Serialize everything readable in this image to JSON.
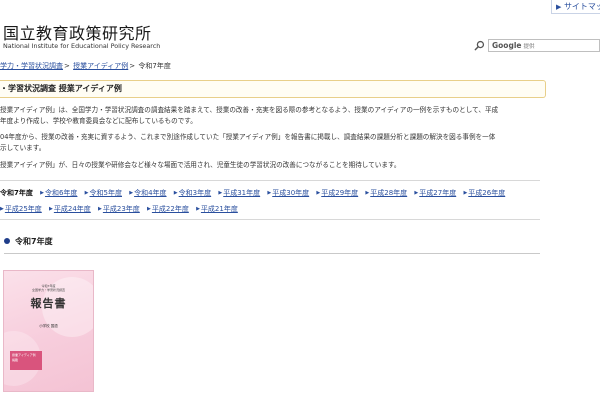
{
  "header": {
    "sitemap_label": "サイトマップ",
    "logo_jp": "国立教育政策研究所",
    "logo_en": "National Institute for Educational Policy Research",
    "search_provider": "Google",
    "search_suffix": "提供"
  },
  "breadcrumb": {
    "item1": "学力・学習状況調査",
    "item2": "授業アイディア例",
    "current": "令和7年度"
  },
  "page_title": "・学習状況調査 授業アイディア例",
  "paragraphs": [
    "授業アイディア例」は、全国学力・学習状況調査の調査結果を踏まえて、授業の改善・充実を図る際の参考となるよう、授業のアイディアの一例を示すものとして、平成",
    "年度より作成し、学校や教育委員会などに配布しているものです。",
    "04年度から、授業の改善・充実に資するよう、これまで別途作成していた「授業アイディア例」を報告書に掲載し、調査結果の課題分析と課題の解決を図る事例を一体",
    "示しています。",
    "授業アイディア例」が、日々の授業や研修会など様々な場面で活用され、児童生徒の学習状況の改善につながることを期待しています。"
  ],
  "years": {
    "current": "令和7年度",
    "row1": [
      "令和6年度",
      "令和5年度",
      "令和4年度",
      "令和3年度",
      "平成31年度",
      "平成30年度",
      "平成29年度",
      "平成28年度",
      "平成27年度",
      "平成26年度"
    ],
    "row2": [
      "平成25年度",
      "平成24年度",
      "平成23年度",
      "平成22年度",
      "平成21年度"
    ]
  },
  "section": {
    "heading": "令和7年度"
  },
  "cover": {
    "top_line1": "令和7年度",
    "top_line2": "全国学力・学習状況調査",
    "title": "報告書",
    "subject": "小学校 国語",
    "tag": "授業アイディア例",
    "tag_sub": "掲載"
  },
  "colors": {
    "link": "#2a4f9e",
    "title_border": "#e8cf8a",
    "section_dot": "#1f3d8a",
    "cover_pink": "#f7cddc"
  }
}
